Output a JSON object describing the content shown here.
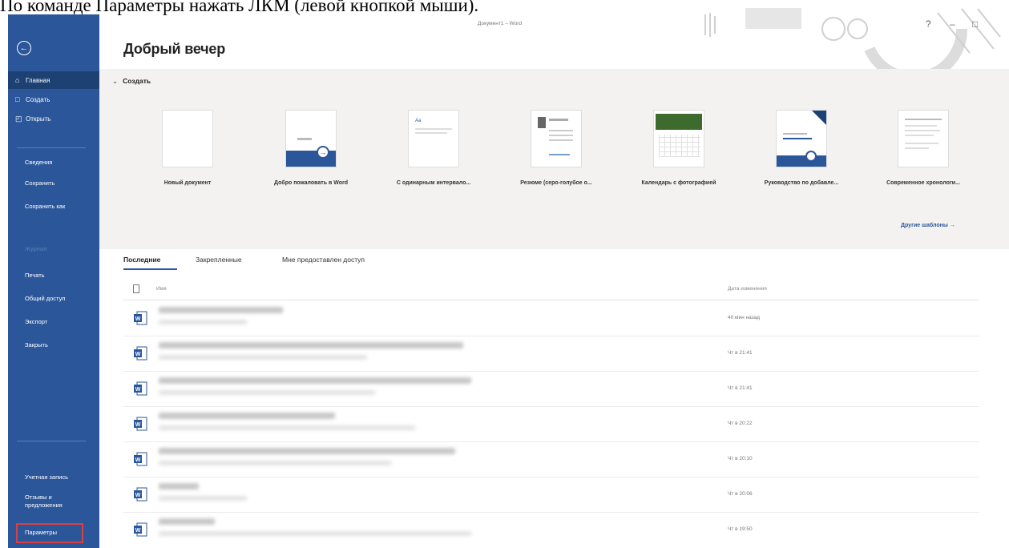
{
  "caption": "По команде Параметры нажать ЛКМ (левой кнопкой мыши).",
  "window": {
    "app_title": "Документ1 – Word",
    "controls": [
      "?",
      "–",
      "□"
    ]
  },
  "sidebar": {
    "back_icon": "arrow-left-circle-icon",
    "primary": [
      {
        "label": "Главная",
        "icon": "home-icon",
        "active": true
      },
      {
        "label": "Создать",
        "icon": "new-doc-icon"
      },
      {
        "label": "Открыть",
        "icon": "folder-icon"
      }
    ],
    "secondary": [
      "Сведения",
      "Сохранить",
      "Сохранить как",
      "Журнал",
      "Печать",
      "Общий доступ",
      "Экспорт",
      "Закрыть"
    ],
    "bottom": [
      "Учетная запись",
      "Отзывы и предложения",
      "Параметры"
    ]
  },
  "main": {
    "greeting": "Добрый вечер",
    "create_header": "Создать",
    "templates": [
      "Новый документ",
      "Добро пожаловать в Word",
      "С одинарным интервало...",
      "Резюме (серо-голубое о...",
      "Календарь с фотографией",
      "Руководство по добавле...",
      "Современное хронологи..."
    ],
    "more_templates": "Другие шаблоны →",
    "tabs": [
      "Последние",
      "Закрепленные",
      "Мне предоставлен доступ"
    ],
    "columns": {
      "name": "Имя",
      "date": "Дата изменения"
    },
    "files": [
      {
        "date": "40 мин назад"
      },
      {
        "date": "Чт в 21:41"
      },
      {
        "date": "Чт в 21:41"
      },
      {
        "date": "Чт в 20:22"
      },
      {
        "date": "Чт в 20:10"
      },
      {
        "date": "Чт в 20:06"
      },
      {
        "date": "Чт в 19:50"
      }
    ]
  },
  "colors": {
    "word_blue": "#2b579a",
    "highlight_red": "#d9403f"
  }
}
